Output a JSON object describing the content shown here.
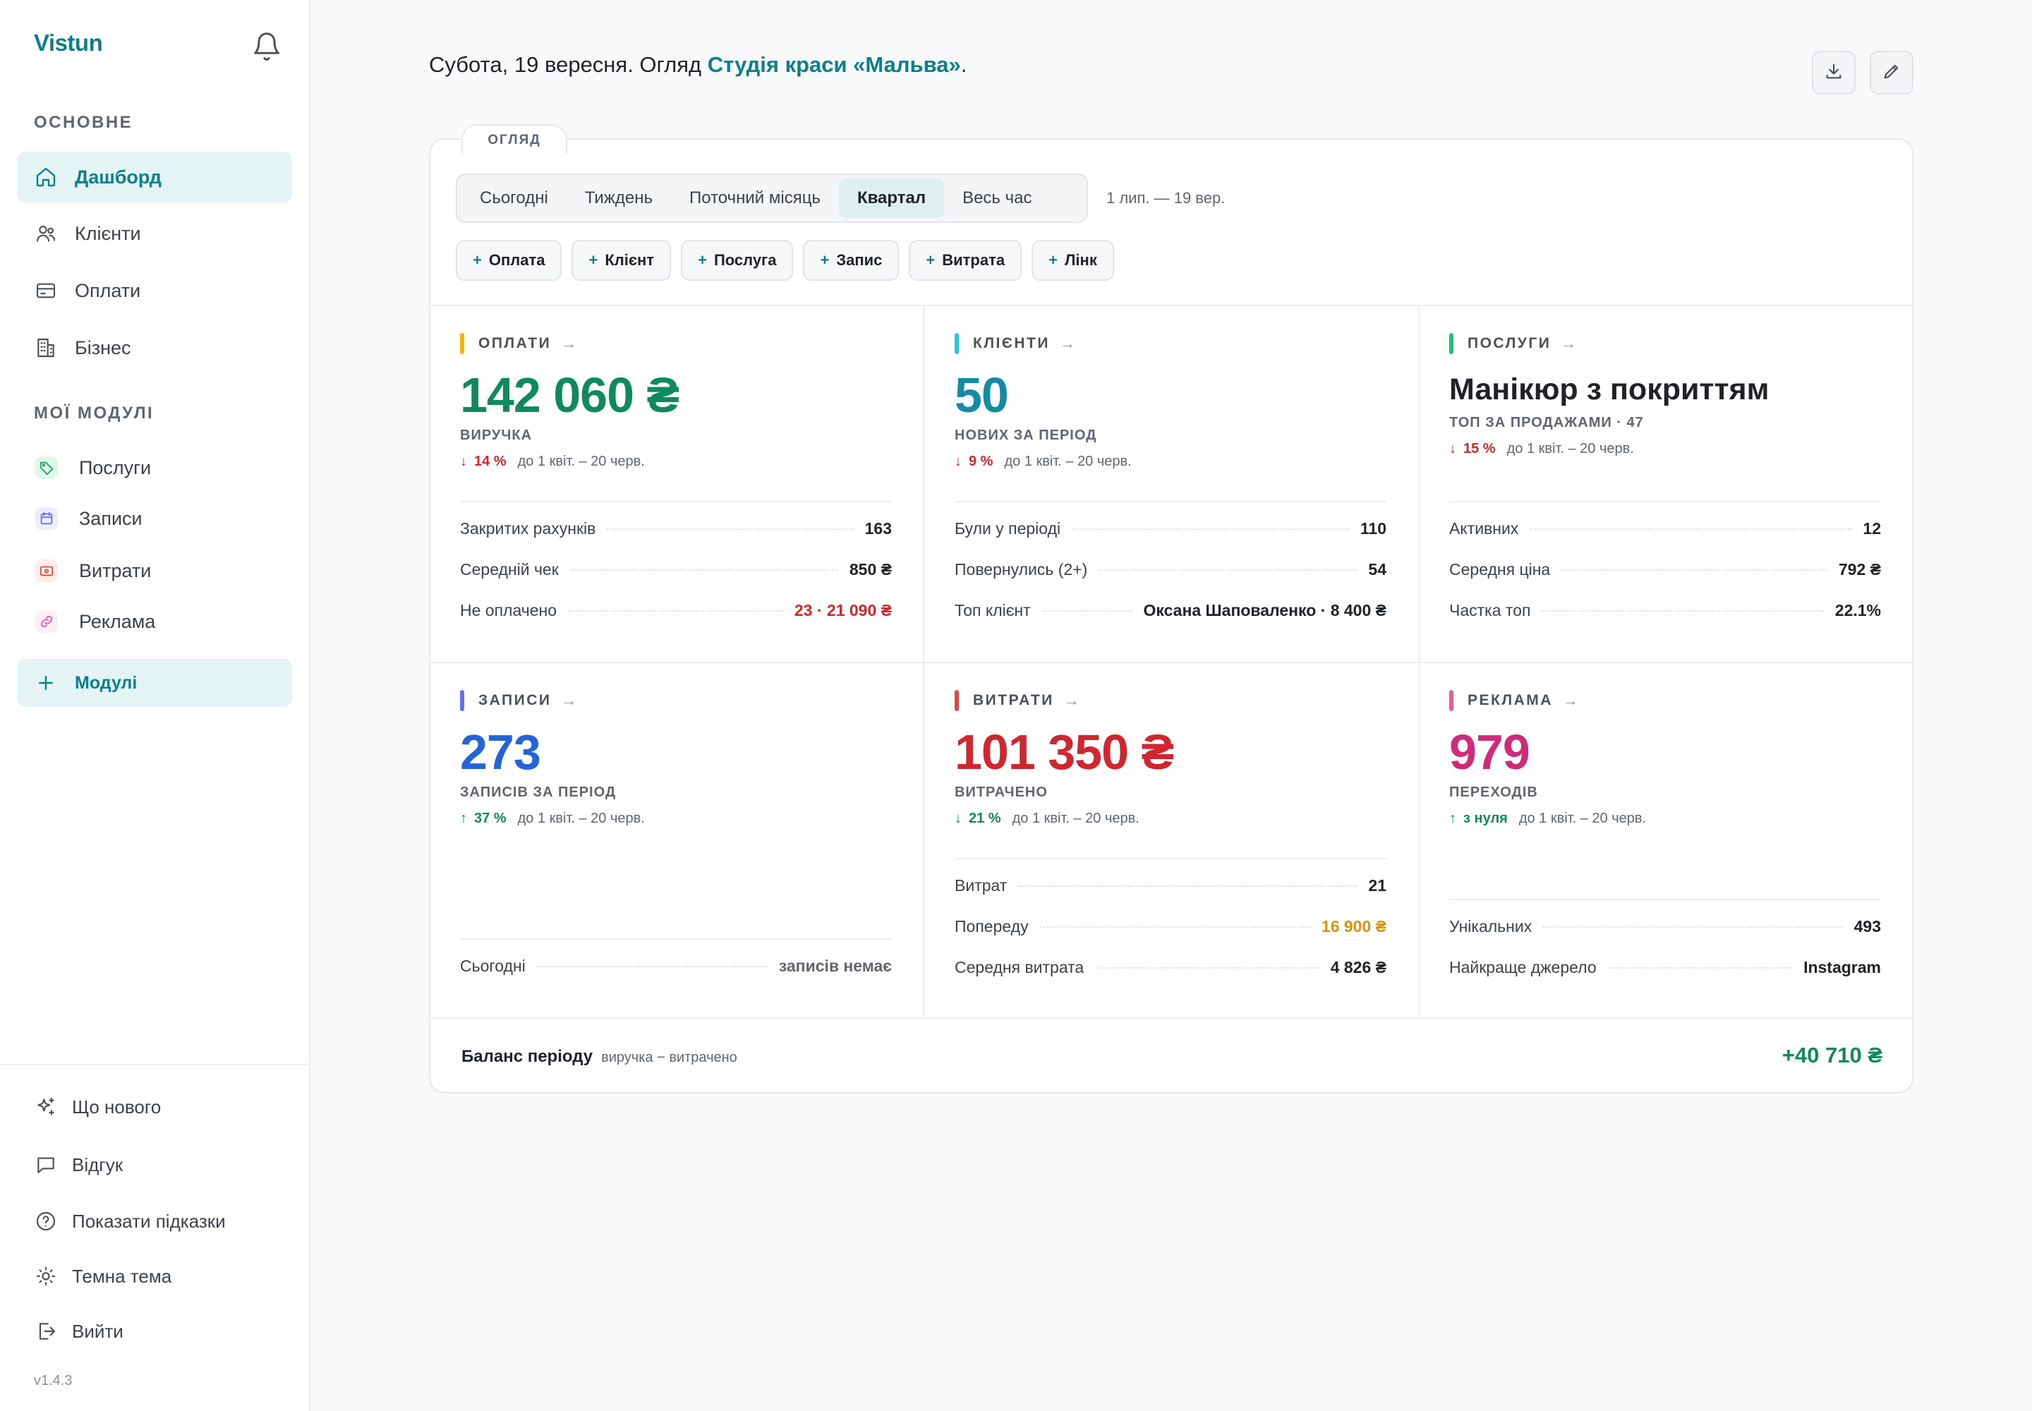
{
  "sidebar": {
    "brand": "Vistun",
    "section_main": "ОСНОВНЕ",
    "main_items": [
      {
        "label": "Дашборд",
        "icon": "home-icon"
      },
      {
        "label": "Клієнти",
        "icon": "users-icon"
      },
      {
        "label": "Оплати",
        "icon": "credit-card-icon"
      },
      {
        "label": "Бізнес",
        "icon": "building-icon"
      }
    ],
    "section_modules": "МОЇ МОДУЛІ",
    "module_items": [
      {
        "label": "Послуги",
        "icon": "tag-icon",
        "color": "#1fa866"
      },
      {
        "label": "Записи",
        "icon": "calendar-icon",
        "color": "#6b6fe8"
      },
      {
        "label": "Витрати",
        "icon": "wallet-icon",
        "color": "#e0483f"
      },
      {
        "label": "Реклама",
        "icon": "link-icon",
        "color": "#e0609a"
      }
    ],
    "add_modules": "Модулі",
    "footer_items": [
      {
        "label": "Що нового",
        "icon": "sparkles-icon"
      },
      {
        "label": "Відгук",
        "icon": "message-icon"
      },
      {
        "label": "Показати підказки",
        "icon": "help-icon"
      },
      {
        "label": "Темна тема",
        "icon": "sun-icon"
      },
      {
        "label": "Вийти",
        "icon": "logout-icon"
      }
    ],
    "version": "v1.4.3"
  },
  "header": {
    "headline_prefix": "Субота, 19 вересня. Огляд ",
    "studio_name": "Студія краси «Мальва»",
    "headline_suffix": "."
  },
  "overview": {
    "tab_label": "ОГЛЯД",
    "periods": [
      "Сьогодні",
      "Тиждень",
      "Поточний місяць",
      "Квартал",
      "Весь час"
    ],
    "active_period": "Квартал",
    "range": "1 лип. — 19 вер.",
    "quick_actions": [
      "Оплата",
      "Клієнт",
      "Послуга",
      "Запис",
      "Витрата",
      "Лінк"
    ]
  },
  "cards": {
    "payments": {
      "title": "ОПЛАТИ",
      "bar_color": "#f4b400",
      "value_color": "#0f8a5f",
      "value": "142 060 ₴",
      "sub": "ВИРУЧКА",
      "delta_arrow": "↓",
      "delta": "14 %",
      "delta_color": "#d0262f",
      "delta_note": "до 1 квіт. – 20 черв.",
      "stats": [
        {
          "label": "Закритих рахунків",
          "value": "163",
          "color": "#1f2328"
        },
        {
          "label": "Середній чек",
          "value": "850 ₴",
          "color": "#1f2328"
        },
        {
          "label": "Не оплачено",
          "value": "23 · 21 090 ₴",
          "color": "#d0262f"
        }
      ]
    },
    "clients": {
      "title": "КЛІЄНТИ",
      "bar_color": "#27c6dc",
      "value_color": "#138aa6",
      "value": "50",
      "sub": "НОВИХ ЗА ПЕРІОД",
      "delta_arrow": "↓",
      "delta": "9 %",
      "delta_color": "#d0262f",
      "delta_note": "до 1 квіт. – 20 черв.",
      "stats": [
        {
          "label": "Були у періоді",
          "value": "110",
          "color": "#1f2328"
        },
        {
          "label": "Повернулись (2+)",
          "value": "54",
          "color": "#1f2328"
        },
        {
          "label": "Топ клієнт",
          "value": "Оксана Шаповаленко · 8 400 ₴",
          "color": "#1f2328"
        }
      ]
    },
    "services": {
      "title": "ПОСЛУГИ",
      "bar_color": "#22c07a",
      "value_color": "#1f2328",
      "value": "Манікюр з покриттям",
      "sub": "ТОП ЗА ПРОДАЖАМИ · 47",
      "delta_arrow": "↓",
      "delta": "15 %",
      "delta_color": "#d0262f",
      "delta_note": "до 1 квіт. – 20 черв.",
      "stats": [
        {
          "label": "Активних",
          "value": "12",
          "color": "#1f2328"
        },
        {
          "label": "Середня ціна",
          "value": "792 ₴",
          "color": "#1f2328"
        },
        {
          "label": "Частка топ",
          "value": "22.1%",
          "color": "#1f2328"
        }
      ]
    },
    "bookings": {
      "title": "ЗАПИСИ",
      "bar_color": "#6b6fe8",
      "value_color": "#2563d8",
      "value": "273",
      "sub": "ЗАПИСІВ ЗА ПЕРІОД",
      "delta_arrow": "↑",
      "delta": "37 %",
      "delta_color": "#0f8a5f",
      "delta_note": "до 1 квіт. – 20 черв.",
      "stats": [
        {
          "label": "Сьогодні",
          "value": "записів немає",
          "color": "#5f6670"
        }
      ]
    },
    "expenses": {
      "title": "ВИТРАТИ",
      "bar_color": "#e0483f",
      "value_color": "#d0262f",
      "value": "101 350 ₴",
      "sub": "ВИТРАЧЕНО",
      "delta_arrow": "↓",
      "delta": "21 %",
      "delta_color": "#0f8a5f",
      "delta_note": "до 1 квіт. – 20 черв.",
      "stats": [
        {
          "label": "Витрат",
          "value": "21",
          "color": "#1f2328"
        },
        {
          "label": "Попереду",
          "value": "16 900 ₴",
          "color": "#d9930a"
        },
        {
          "label": "Середня витрата",
          "value": "4 826 ₴",
          "color": "#1f2328"
        }
      ]
    },
    "ads": {
      "title": "РЕКЛАМА",
      "bar_color": "#e0609a",
      "value_color": "#d02a7a",
      "value": "979",
      "sub": "ПЕРЕХОДІВ",
      "delta_arrow": "↑",
      "delta": "з нуля",
      "delta_color": "#0f8a5f",
      "delta_note": "до 1 квіт. – 20 черв.",
      "stats": [
        {
          "label": "Унікальних",
          "value": "493",
          "color": "#1f2328"
        },
        {
          "label": "Найкраще джерело",
          "value": "Instagram",
          "color": "#1f2328"
        }
      ]
    }
  },
  "balance": {
    "label": "Баланс періоду",
    "note": "виручка − витрачено",
    "value": "+40 710 ₴"
  }
}
